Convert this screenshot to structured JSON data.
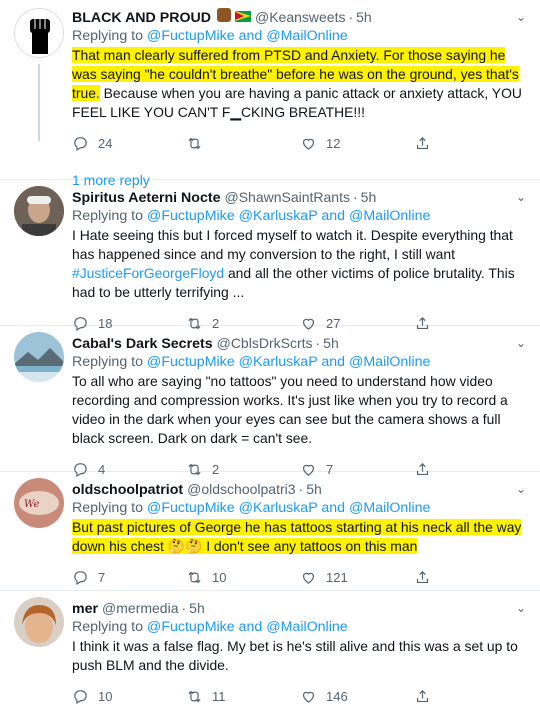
{
  "tweets": [
    {
      "name": "BLACK AND PROUD",
      "handle": "@Keansweets",
      "time": "5h",
      "reply_prefix": "Replying to ",
      "reply_to": "@FuctupMike and @MailOnline",
      "body_hl": "That man clearly suffered from PTSD and Anxiety.  For those saying he was saying \"he couldn't breathe\" before he was on the ground, yes that's true.",
      "body_rest": " Because when you are having a panic attack or anxiety attack, YOU FEEL LIKE YOU CAN'T F▁CKING BREATHE!!!",
      "replies": "24",
      "retweets": "",
      "likes": "12",
      "more_reply": "1 more reply"
    },
    {
      "name": "Spiritus Aeterni Nocte",
      "handle": "@ShawnSaintRants",
      "time": "5h",
      "reply_prefix": "Replying to ",
      "reply_to": "@FuctupMike @KarluskaP and @MailOnline",
      "body_a": "I Hate seeing this but I forced myself to watch it. Despite everything that has happened since and my conversion to the right, I still want ",
      "body_tag": "#JusticeForGeorgeFloyd",
      "body_b": " and all the other victims of police brutality. This had to be utterly terrifying ...",
      "replies": "18",
      "retweets": "2",
      "likes": "27"
    },
    {
      "name": "Cabal's Dark Secrets",
      "handle": "@CblsDrkScrts",
      "time": "5h",
      "reply_prefix": "Replying to ",
      "reply_to": "@FuctupMike @KarluskaP and @MailOnline",
      "body": "To all who are saying \"no tattoos\" you need to understand how video recording and compression works. It's just like when you try to record a video in the dark when your eyes can see but the camera shows a full black screen. Dark on dark = can't see.",
      "replies": "4",
      "retweets": "2",
      "likes": "7"
    },
    {
      "name": "oldschoolpatriot",
      "handle": "@oldschoolpatri3",
      "time": "5h",
      "reply_prefix": "Replying to ",
      "reply_to": "@FuctupMike @KarluskaP and @MailOnline",
      "body_hl": "But past pictures of George he has tattoos starting at his neck all the way down his chest 🤔🤔 I don't see any tattoos on this man",
      "replies": "7",
      "retweets": "10",
      "likes": "121"
    },
    {
      "name": "mer",
      "handle": "@mermedia",
      "time": "5h",
      "reply_prefix": "Replying to ",
      "reply_to": "@FuctupMike and @MailOnline",
      "body": "I think it was a false flag. My bet is he's still alive and this was a set up to push BLM and the divide.",
      "replies": "10",
      "retweets": "11",
      "likes": "146"
    }
  ],
  "separator": " · "
}
